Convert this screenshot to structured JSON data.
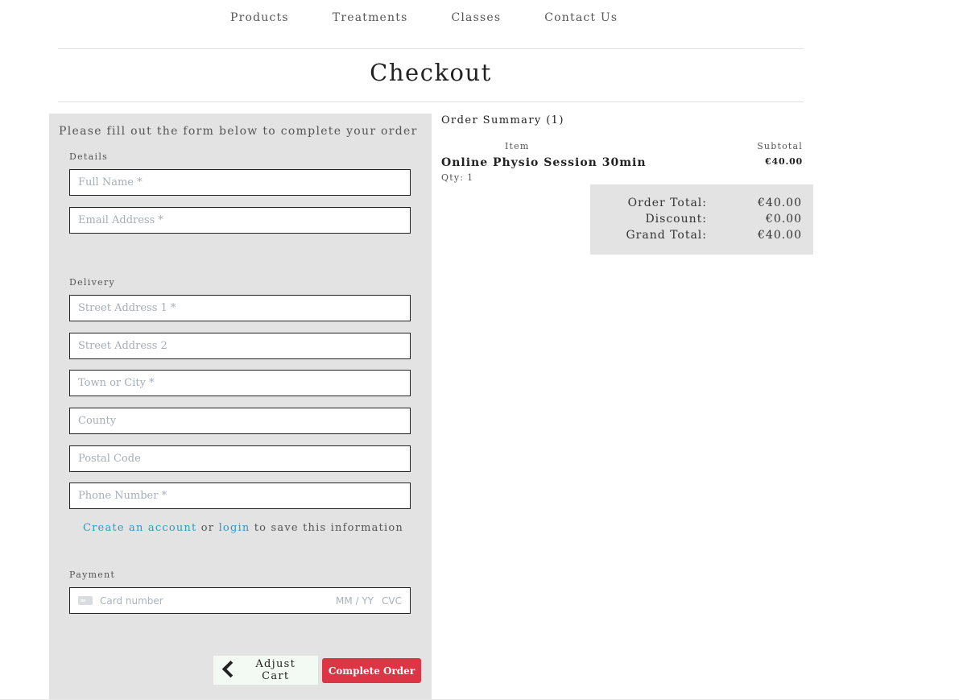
{
  "nav": {
    "items": [
      "Products",
      "Treatments",
      "Classes",
      "Contact Us"
    ]
  },
  "page": {
    "title": "Checkout"
  },
  "form": {
    "intro": "Please fill out the form below to complete your order",
    "details_label": "Details",
    "full_name_placeholder": "Full Name *",
    "email_placeholder": "Email Address *",
    "delivery_label": "Delivery",
    "street1_placeholder": "Street Address 1 *",
    "street2_placeholder": "Street Address 2",
    "town_placeholder": "Town or City *",
    "county_placeholder": "County",
    "postcode_placeholder": "Postal Code",
    "phone_placeholder": "Phone Number *",
    "save_info": {
      "create_account": "Create an account",
      "or": "or",
      "login": "login",
      "rest": "to save this information"
    },
    "payment_label": "Payment",
    "card": {
      "number_placeholder": "Card number",
      "expiry_placeholder": "MM / YY",
      "cvc_placeholder": "CVC",
      "icon": "credit-card-icon"
    },
    "adjust_cart_label": "Adjust Cart",
    "complete_order_label": "Complete Order"
  },
  "summary": {
    "title": "Order Summary (1)",
    "col_item": "Item",
    "col_subtotal": "Subtotal",
    "items": [
      {
        "name": "Online Physio Session 30min",
        "qty_label": "Qty:",
        "qty": "1",
        "subtotal": "€40.00"
      }
    ],
    "order_total_label": "Order Total:",
    "order_total": "€40.00",
    "discount_label": "Discount:",
    "discount": "€0.00",
    "grand_total_label": "Grand Total:",
    "grand_total": "€40.00"
  },
  "colors": {
    "panel_bg": "#e4e3e3",
    "link": "#2e9bbf",
    "primary_button": "#dc3545",
    "adjust_button_bg": "#f2faf3"
  }
}
